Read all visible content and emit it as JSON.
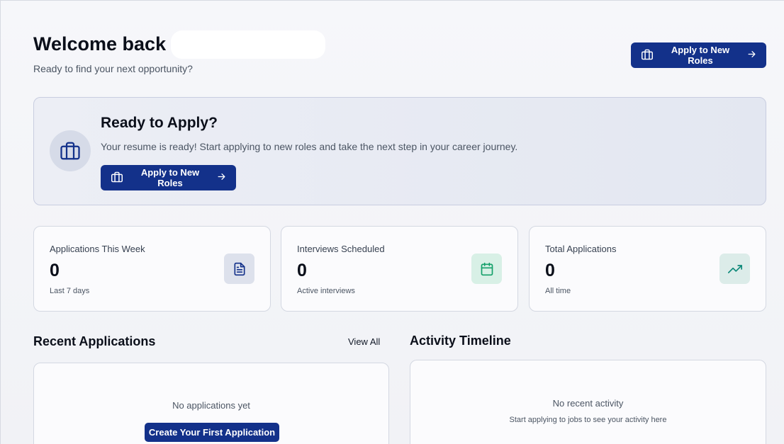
{
  "header": {
    "title": "Welcome back",
    "subtitle": "Ready to find your next opportunity?",
    "cta_label": "Apply to New Roles"
  },
  "banner": {
    "title": "Ready to Apply?",
    "text": "Your resume is ready! Start applying to new roles and take the next step in your career journey.",
    "cta_label": "Apply to New Roles",
    "icon": "briefcase-icon"
  },
  "stats": [
    {
      "label": "Applications This Week",
      "value": "0",
      "note": "Last 7 days",
      "icon": "document-icon",
      "icon_bg": "#dde1ec",
      "icon_color": "#13318a"
    },
    {
      "label": "Interviews Scheduled",
      "value": "0",
      "note": "Active interviews",
      "icon": "calendar-icon",
      "icon_bg": "#d8f0e6",
      "icon_color": "#14a06a"
    },
    {
      "label": "Total Applications",
      "value": "0",
      "note": "All time",
      "icon": "trending-up-icon",
      "icon_bg": "#dcece9",
      "icon_color": "#0f8a7a"
    }
  ],
  "recent": {
    "title": "Recent Applications",
    "view_all": "View All",
    "empty": "No applications yet",
    "cta_label": "Create Your First Application"
  },
  "activity": {
    "title": "Activity Timeline",
    "empty": "No recent activity",
    "hint": "Start applying to jobs to see your activity here"
  },
  "colors": {
    "primary": "#13318a",
    "background": "#f3f4f7"
  }
}
